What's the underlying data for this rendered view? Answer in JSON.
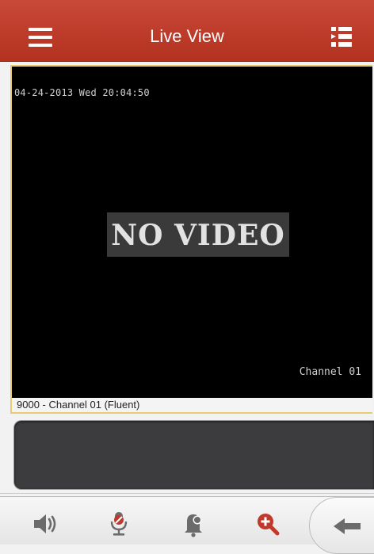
{
  "header": {
    "title": "Live View"
  },
  "video": {
    "osd_datetime": "04-24-2013 Wed 20:04:50",
    "status_text": "NO VIDEO",
    "osd_channel": "Channel 01",
    "caption": "9000 - Channel 01 (Fluent)"
  },
  "toolbar": {
    "items": [
      "speaker-icon",
      "microphone-off-icon",
      "alarm-bell-icon",
      "zoom-in-icon",
      "back-arrow-icon"
    ],
    "active_color": "#c0392b"
  },
  "colors": {
    "header_red": "#bd3b2a",
    "selected_border": "#e9cb74",
    "icon_gray": "#6b6b6b"
  }
}
